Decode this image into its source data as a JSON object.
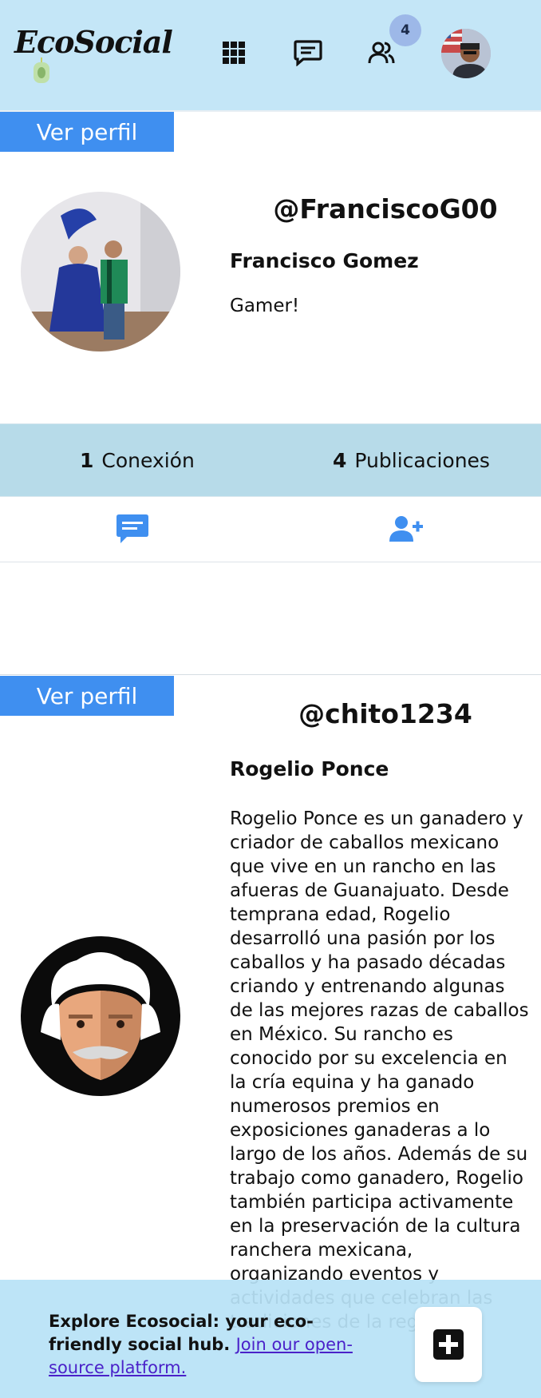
{
  "header": {
    "brand": "EcoSocial",
    "nav": [
      "grid-icon",
      "messages-icon",
      "friends-icon"
    ],
    "notification_count": "4"
  },
  "profiles": [
    {
      "view_label": "Ver perfil",
      "username": "@FranciscoG00",
      "full_name": "Francisco Gomez",
      "bio": "Gamer!",
      "connections_count": "1",
      "connections_label": "Conexión",
      "posts_count": "4",
      "posts_label": "Publicaciones"
    },
    {
      "view_label": "Ver perfil",
      "username": "@chito1234",
      "full_name": "Rogelio Ponce",
      "bio": "Rogelio Ponce es un ganadero y criador de caballos mexicano que vive en un rancho en las afueras de Guanajuato. Desde temprana edad, Rogelio desarrolló una pasión por los caballos y ha pasado décadas criando y entrenando algunas de las mejores razas de caballos en México. Su rancho es conocido por su excelencia en la cría equina y ha ganado numerosos premios en exposiciones ganaderas a lo largo de los años. Además de su trabajo como ganadero, Rogelio también participa activamente en la preservación de la cultura ranchera mexicana, organizando eventos y actividades que celebran las tradiciones de la región."
    }
  ],
  "footer": {
    "text": "Explore Ecosocial: your eco-friendly social hub.",
    "link": "Join our open-source platform."
  },
  "colors": {
    "header_bg": "#c4e6f7",
    "accent": "#3f8ff0",
    "stats_bg": "#b7dbe9",
    "link": "#4a21c9"
  }
}
